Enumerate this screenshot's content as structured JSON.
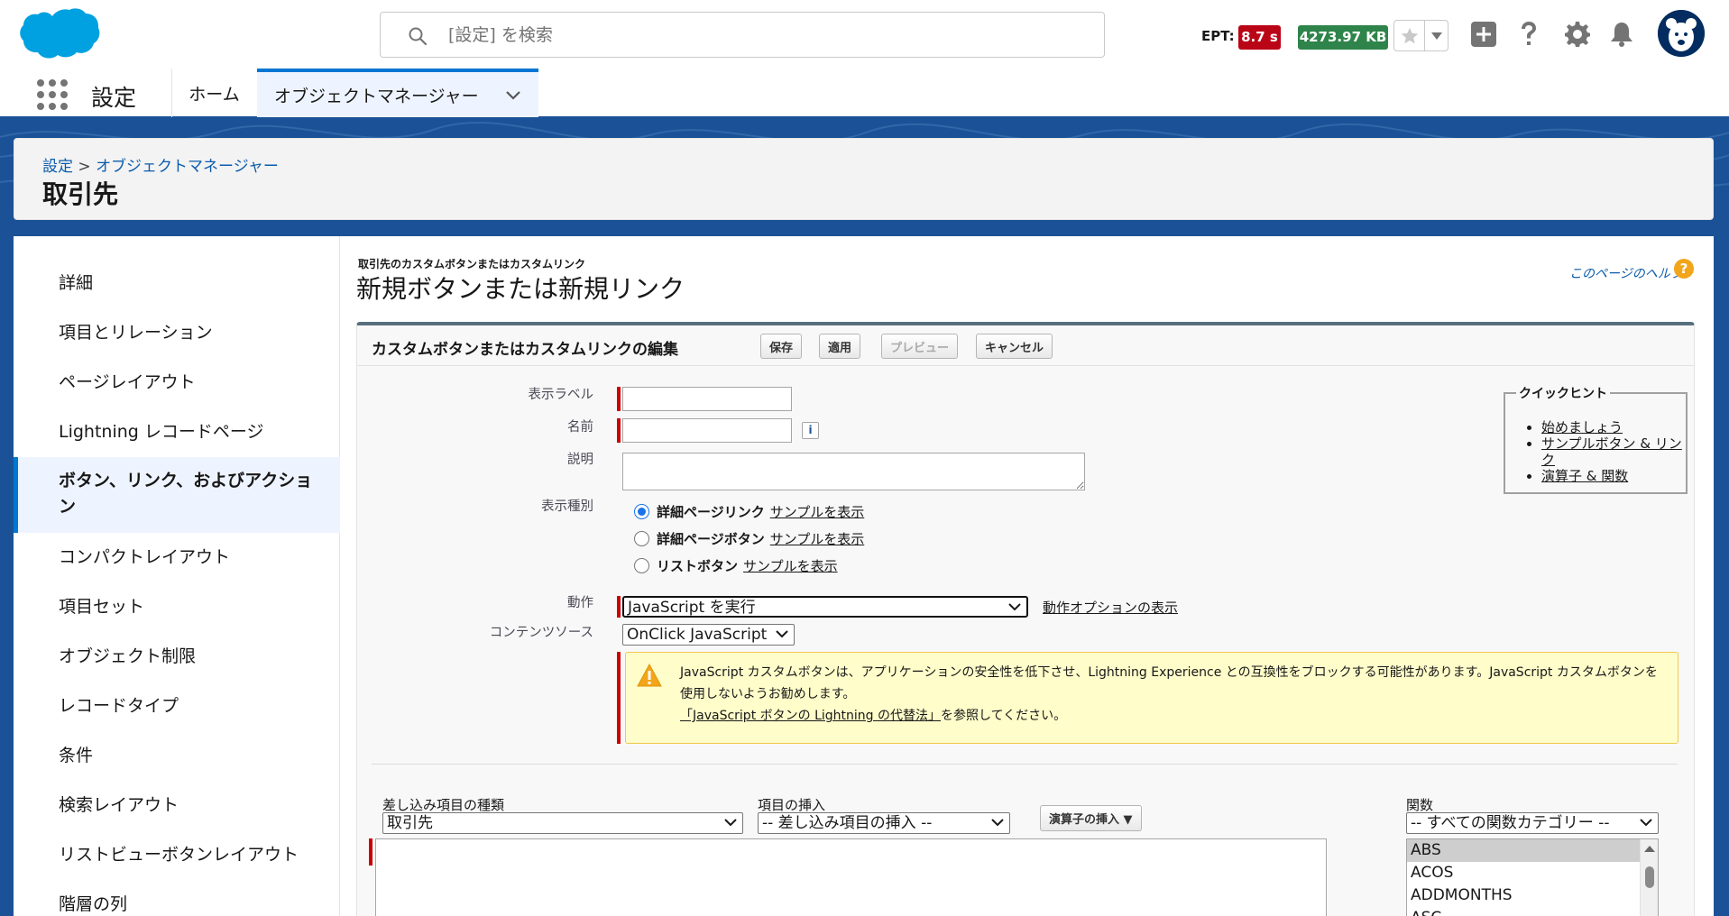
{
  "header": {
    "search_placeholder": "[設定] を検索",
    "ept_label": "EPT:",
    "ept_value": "8.7 s",
    "kb_value": "4273.97 KB"
  },
  "nav": {
    "app_name": "設定",
    "tabs": [
      {
        "label": "ホーム"
      },
      {
        "label": "オブジェクトマネージャー"
      }
    ]
  },
  "setup_header": {
    "breadcrumb_root": "設定",
    "breadcrumb_sep": ">",
    "breadcrumb_current": "オブジェクトマネージャー",
    "title": "取引先"
  },
  "sidebar": {
    "items": [
      {
        "label": "詳細"
      },
      {
        "label": "項目とリレーション"
      },
      {
        "label": "ページレイアウト"
      },
      {
        "label": "Lightning レコードページ"
      },
      {
        "label": "ボタン、リンク、およびアクション"
      },
      {
        "label": "コンパクトレイアウト"
      },
      {
        "label": "項目セット"
      },
      {
        "label": "オブジェクト制限"
      },
      {
        "label": "レコードタイプ"
      },
      {
        "label": "条件"
      },
      {
        "label": "検索レイアウト"
      },
      {
        "label": "リストビューボタンレイアウト"
      },
      {
        "label": "階層の列"
      }
    ]
  },
  "content": {
    "subtitle": "取引先のカスタムボタンまたはカスタムリンク",
    "title": "新規ボタンまたは新規リンク",
    "help_link": "このページのヘルプ",
    "help_icon": "?"
  },
  "edit_block": {
    "title": "カスタムボタンまたはカスタムリンクの編集",
    "buttons": {
      "save": "保存",
      "apply": "適用",
      "preview": "プレビュー",
      "cancel": "キャンセル"
    },
    "labels": {
      "display_label": "表示ラベル",
      "name": "名前",
      "description": "説明",
      "display_type": "表示種別",
      "behavior": "動作",
      "content_source": "コンテンツソース"
    },
    "values": {
      "display_label": "",
      "name": "",
      "description": ""
    },
    "info_icon": "i",
    "display_types": [
      {
        "label": "詳細ページリンク",
        "link": "サンプルを表示",
        "checked": true
      },
      {
        "label": "詳細ページボタン",
        "link": "サンプルを表示",
        "checked": false
      },
      {
        "label": "リストボタン",
        "link": "サンプルを表示",
        "checked": false
      }
    ],
    "behavior_value": "JavaScript を実行",
    "behavior_link": "動作オプションの表示",
    "content_source_value": "OnClick JavaScript",
    "warning": {
      "line1": "JavaScript カスタムボタンは、アプリケーションの安全性を低下させ、Lightning Experience との互換性をブロックする可能性があります。JavaScript カスタムボタンを",
      "line2": "使用しないようお勧めします。",
      "link": "「JavaScript ボタンの Lightning の代替法」",
      "after_link": "を参照してください。"
    },
    "quick_hints": {
      "title": "クイックヒント",
      "items": [
        "始めましょう",
        "サンプルボタン & リンク",
        "演算子 & 関数"
      ]
    },
    "merge": {
      "field_type_label": "差し込み項目の種類",
      "field_type_value": "取引先",
      "insert_field_label": "項目の挿入",
      "insert_field_value": "-- 差し込み項目の挿入 --",
      "operator_button": "演算子の挿入 ▼",
      "functions_label": "関数",
      "functions_value": "-- すべての関数カテゴリー --",
      "function_items": [
        "ABS",
        "ACOS",
        "ADDMONTHS",
        "ASC"
      ]
    }
  },
  "colors": {
    "brand_blue": "#1b5297",
    "active_tab": "#0176d3",
    "ept_badge": "#ba0517",
    "kb_badge": "#2e844a",
    "required": "#cc0000",
    "warning_bg": "#fffdca"
  }
}
